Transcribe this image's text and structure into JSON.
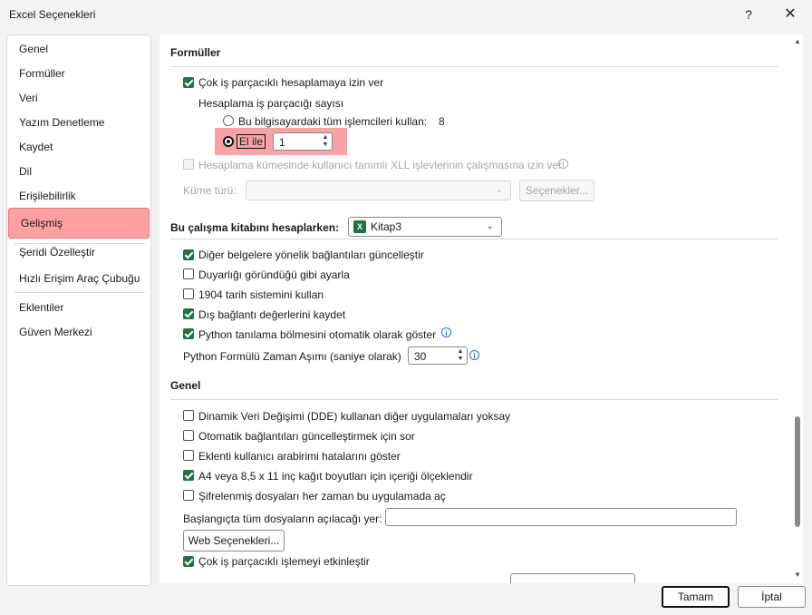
{
  "window": {
    "title": "Excel Seçenekleri",
    "help": "?",
    "close": "✕"
  },
  "sidebar": {
    "items": [
      {
        "label": "Genel"
      },
      {
        "label": "Formüller"
      },
      {
        "label": "Veri"
      },
      {
        "label": "Yazım Denetleme"
      },
      {
        "label": "Kaydet"
      },
      {
        "label": "Dil"
      },
      {
        "label": "Erişilebilirlik"
      },
      {
        "label": "Gelişmiş"
      },
      {
        "label": "Şeridi Özelleştir"
      },
      {
        "label": "Hızlı Erişim Araç Çubuğu"
      },
      {
        "label": "Eklentiler"
      },
      {
        "label": "Güven Merkezi"
      }
    ],
    "selected": "Gelişmiş"
  },
  "formulas": {
    "title": "Formüller",
    "multithread_label": "Çok iş parçacıklı hesaplamaya izin ver",
    "threads_label": "Hesaplama iş parçacığı sayısı",
    "all_processors_label": "Bu bilgisayardaki tüm işlemcileri kullan:",
    "processor_count": "8",
    "manual_label": "El ile",
    "manual_value": "1",
    "xll_label": "Hesaplama kümesinde kullanıcı tanımlı XLL işlevlerinin çalışmasına izin ver",
    "cluster_type_label": "Küme türü:",
    "options_button": "Seçenekler..."
  },
  "workbook": {
    "title": "Bu çalışma kitabını hesaplarken:",
    "selected_book": "Kitap3",
    "items": [
      {
        "label": "Diğer belgelere yönelik bağlantıları güncelleştir",
        "checked": true
      },
      {
        "label": "Duyarlığı göründüğü gibi ayarla",
        "checked": false
      },
      {
        "label": "1904 tarih sistemini kullan",
        "checked": false
      },
      {
        "label": "Dış bağlantı değerlerini kaydet",
        "checked": true
      },
      {
        "label": "Python tanılama bölmesini otomatik olarak göster",
        "checked": true
      }
    ],
    "python_timeout_label": "Python Formülü Zaman Aşımı (saniye olarak)",
    "python_timeout_value": "30"
  },
  "general": {
    "title": "Genel",
    "items": [
      {
        "label": "Dinamik Veri Değişimi (DDE) kullanan diğer uygulamaları yoksay",
        "checked": false
      },
      {
        "label": "Otomatik bağlantıları güncelleştirmek için sor",
        "checked": false
      },
      {
        "label": "Eklenti kullanıcı arabirimi hatalarını göster",
        "checked": false
      },
      {
        "label": "A4 veya 8,5 x 11 inç kağıt boyutları için içeriği ölçeklendir",
        "checked": true
      },
      {
        "label": "Şifrelenmiş dosyaları her zaman bu uygulamada aç",
        "checked": false
      }
    ],
    "startup_label": "Başlangıçta tüm dosyaların açılacağı yer:",
    "startup_value": "",
    "web_options_button": "Web Seçenekleri...",
    "multithread_processing_label": "Çok iş parçacıklı işlemeyi etkinleştir",
    "multithread_processing_checked": true
  },
  "footer": {
    "ok": "Tamam",
    "cancel": "İptal"
  },
  "colors": {
    "accent": "#217346",
    "highlight": "#f7a3a6",
    "selected_nav": "#ff9fa2"
  }
}
